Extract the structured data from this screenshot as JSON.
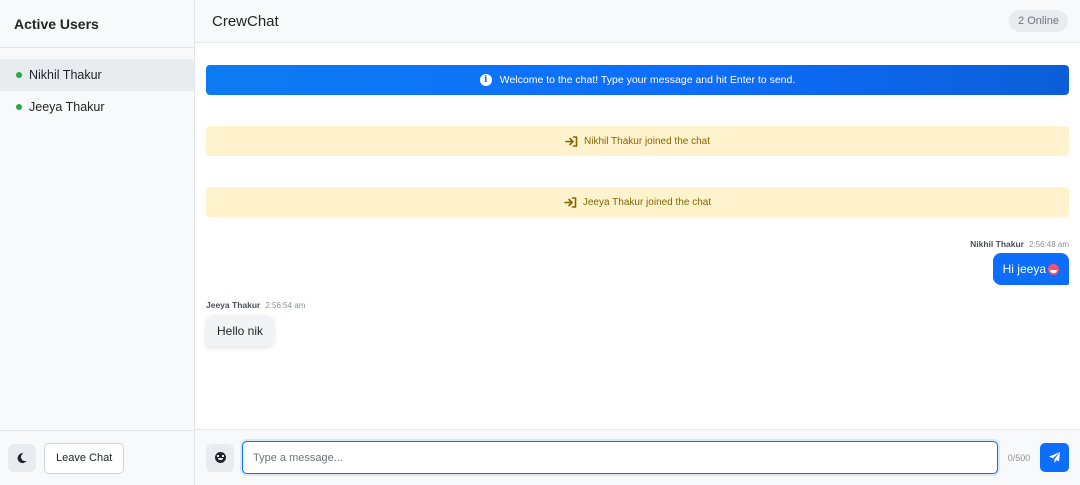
{
  "sidebar": {
    "title": "Active Users",
    "users": [
      {
        "name": "Nikhil Thakur",
        "status": "online"
      },
      {
        "name": "Jeeya Thakur",
        "status": "online"
      }
    ],
    "theme_toggle_icon": "moon-icon",
    "leave_label": "Leave Chat"
  },
  "header": {
    "title": "CrewChat",
    "online_count": "2 Online"
  },
  "chat": {
    "welcome": "Welcome to the chat! Type your message and hit Enter to send.",
    "welcome_icon": "info-icon",
    "system_messages": [
      "Nikhil Thakur joined the chat",
      "Jeeya Thakur joined the chat"
    ],
    "system_icon": "sign-in-icon",
    "messages": [
      {
        "author": "Nikhil Thakur",
        "time": "2:56:48 am",
        "text": "Hi jeeya",
        "emoji": "grinning-face",
        "direction": "outgoing"
      },
      {
        "author": "Jeeya Thakur",
        "time": "2:56:54 am",
        "text": "Hello nik",
        "direction": "incoming"
      }
    ]
  },
  "composer": {
    "placeholder": "Type a message...",
    "value": "",
    "char_count": "0/500",
    "emoji_icon": "smiley-icon",
    "send_icon": "paper-plane-icon"
  },
  "colors": {
    "accent": "#0d6efd",
    "online": "#28a745",
    "notice_bg": "#fff3cd",
    "notice_text": "#856404"
  }
}
